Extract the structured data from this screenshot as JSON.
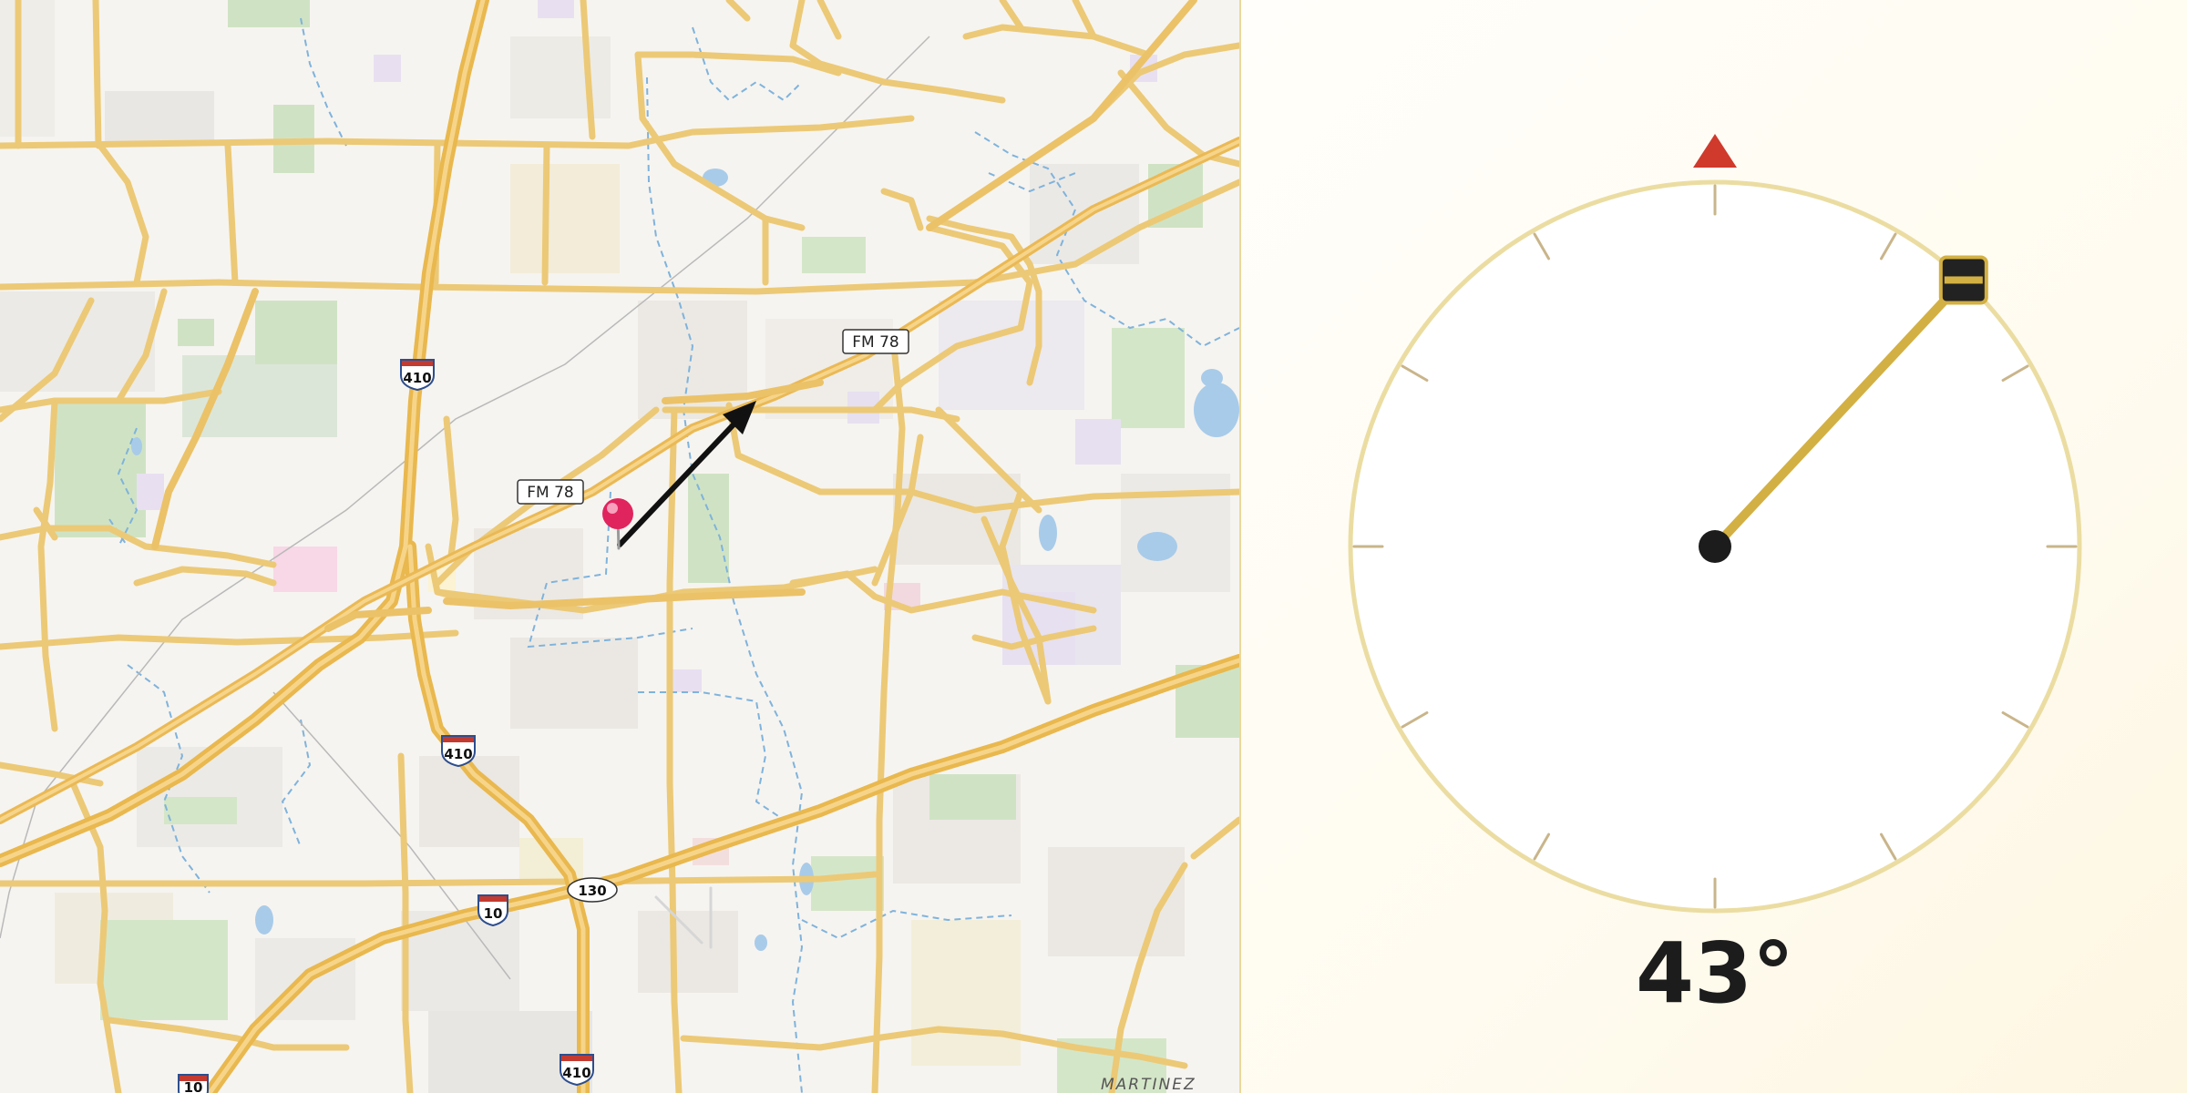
{
  "map": {
    "road_labels": [
      "FM 78",
      "FM 78"
    ],
    "shields": {
      "interstate": [
        "410",
        "410",
        "10",
        "10",
        "410"
      ],
      "state": [
        "130"
      ]
    },
    "place_label": "MARTINEZ",
    "pin_icon": "location-pin-icon",
    "arrow_icon": "heading-arrow-icon"
  },
  "compass": {
    "heading_degrees": 43,
    "readout": "43°",
    "north_marker_icon": "north-triangle-icon",
    "needle_handle_icon": "needle-handle-icon",
    "colors": {
      "north_marker": "#cf3a2c",
      "needle": "#d3b043",
      "dial_ring": "#ebdda2",
      "hub": "#1c1c1c"
    }
  }
}
